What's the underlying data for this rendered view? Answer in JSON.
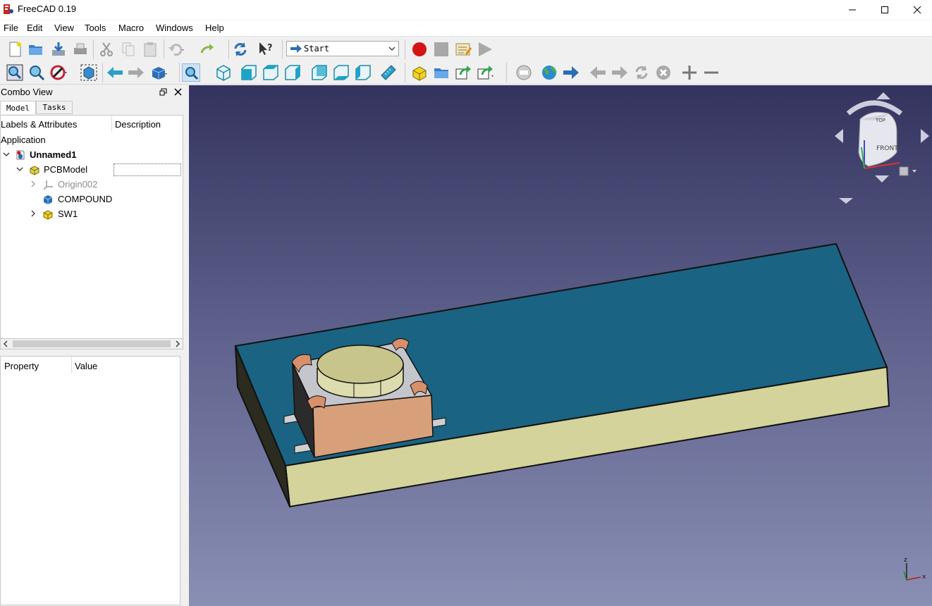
{
  "window": {
    "title": "FreeCAD 0.19"
  },
  "menu": [
    "File",
    "Edit",
    "View",
    "Tools",
    "Macro",
    "Windows",
    "Help"
  ],
  "toolbar": {
    "workbench_selected": "Start"
  },
  "combo_view": {
    "title": "Combo View",
    "tabs": [
      "Model",
      "Tasks"
    ],
    "tree": {
      "col_labels": "Labels & Attributes",
      "col_description": "Description",
      "root": "Application",
      "items": [
        {
          "label": "Unnamed1"
        },
        {
          "label": "PCBModel"
        },
        {
          "label": "Origin002"
        },
        {
          "label": "COMPOUND"
        },
        {
          "label": "SW1"
        }
      ]
    },
    "property": {
      "col_property": "Property",
      "col_value": "Value"
    }
  },
  "navcube": {
    "top_label": "TOP",
    "front_label": "FRONT"
  },
  "colors": {
    "viewport_top": "#33335e",
    "viewport_bottom": "#8a8fb4",
    "pcb_top": "#1a6383",
    "pcb_side": "#d3d39b",
    "switch_body": "#d8a07a"
  }
}
